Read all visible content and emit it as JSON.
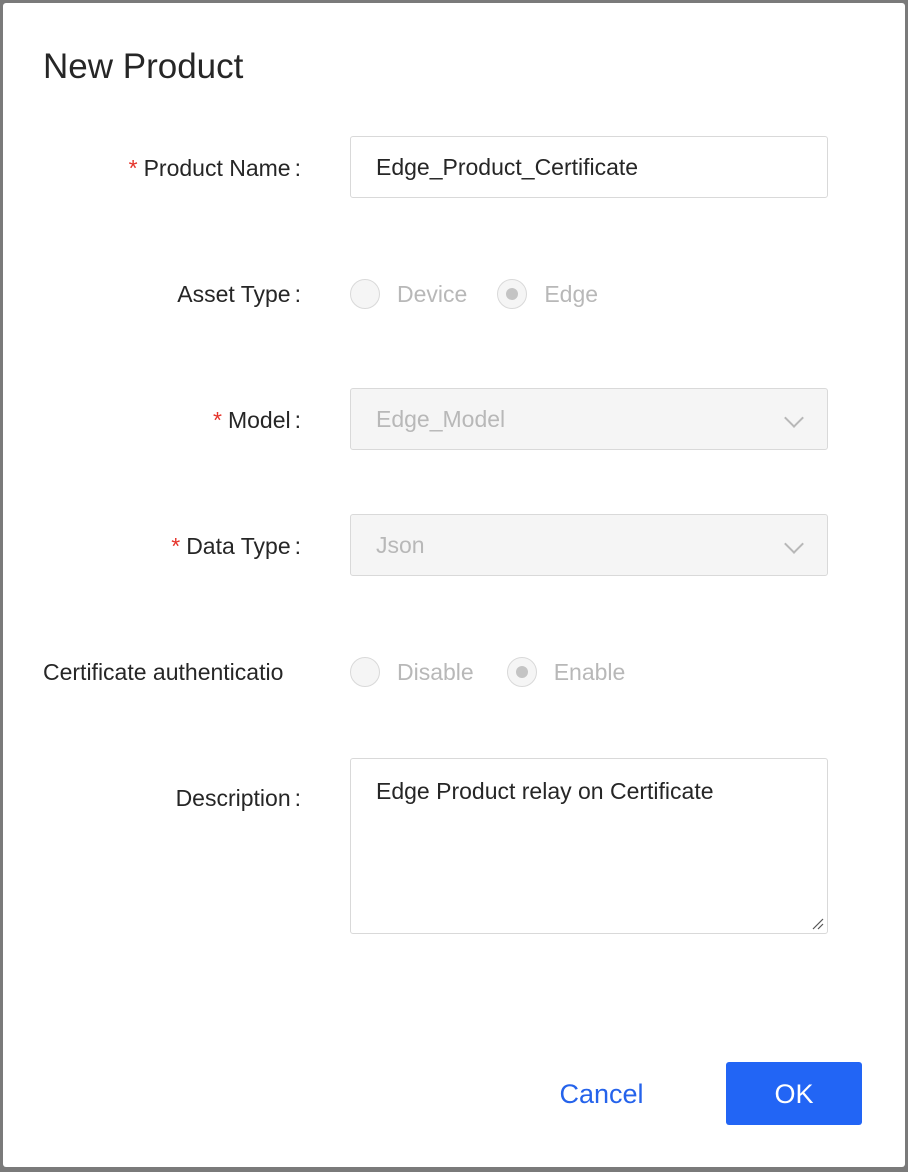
{
  "dialog": {
    "title": "New Product"
  },
  "form": {
    "product_name": {
      "label": "Product Name",
      "required": true,
      "value": "Edge_Product_Certificate"
    },
    "asset_type": {
      "label": "Asset Type",
      "options": [
        {
          "label": "Device",
          "checked": false
        },
        {
          "label": "Edge",
          "checked": true
        }
      ]
    },
    "model": {
      "label": "Model",
      "required": true,
      "value": "Edge_Model"
    },
    "data_type": {
      "label": "Data Type",
      "required": true,
      "value": "Json"
    },
    "certificate_auth": {
      "label": "Certificate authenticatio",
      "options": [
        {
          "label": "Disable",
          "checked": false
        },
        {
          "label": "Enable",
          "checked": true
        }
      ]
    },
    "description": {
      "label": "Description",
      "value": "Edge Product relay on Certificate"
    },
    "colon": ":",
    "required_mark": "*"
  },
  "footer": {
    "cancel_label": "Cancel",
    "ok_label": "OK"
  },
  "colors": {
    "primary": "#2265f5",
    "required": "#e5332a",
    "disabled_text": "#b8b8b8"
  }
}
